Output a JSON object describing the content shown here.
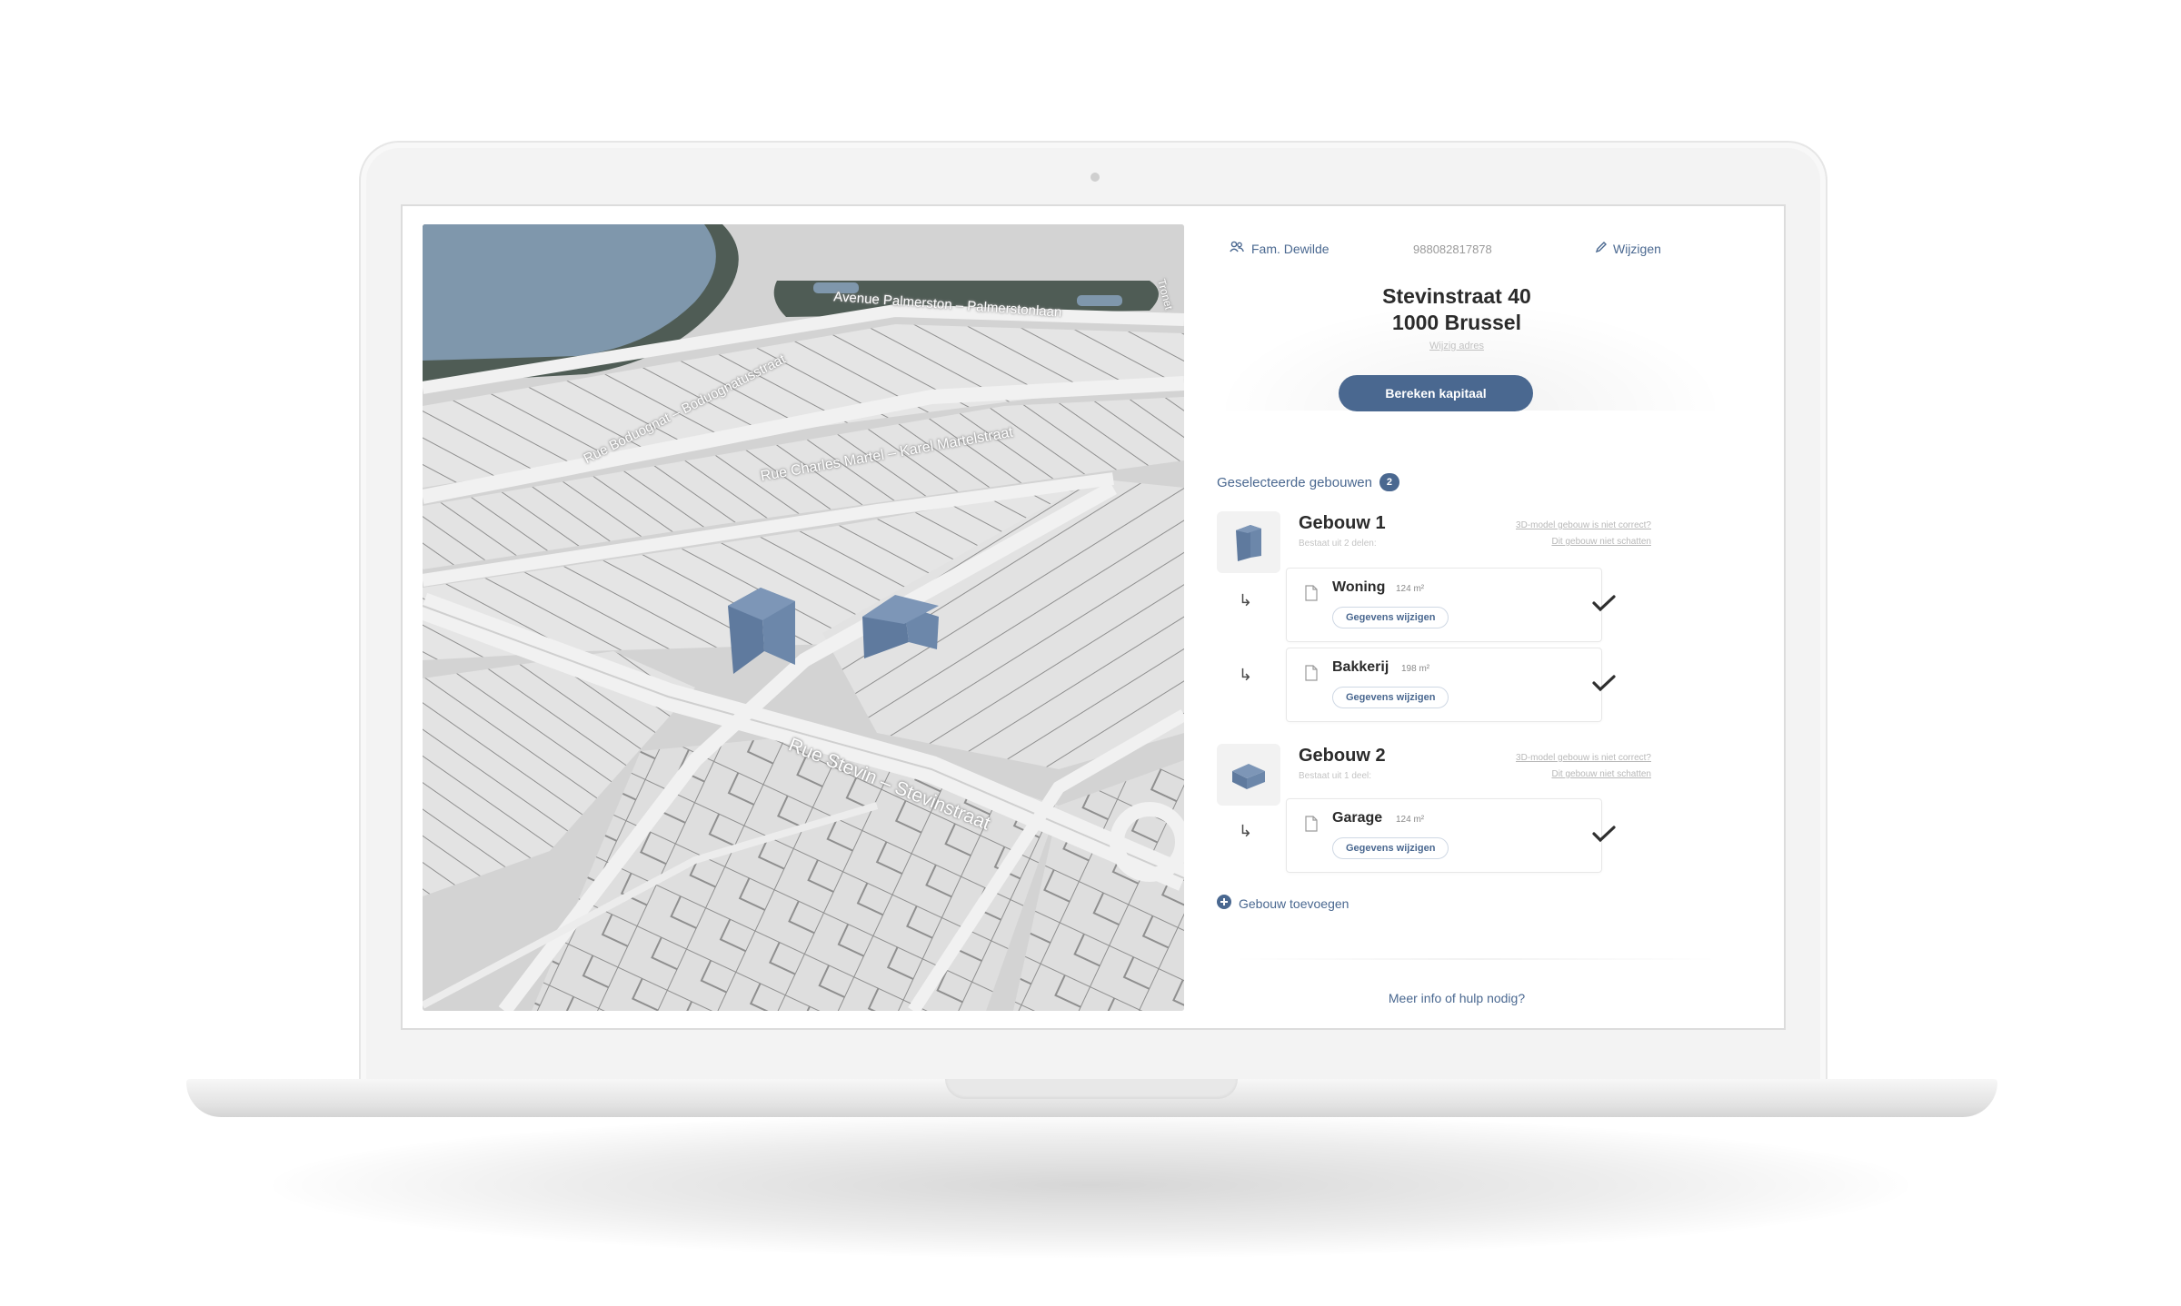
{
  "colors": {
    "accent": "#4a6890",
    "building": "#5f7a9e",
    "water": "#7f97ac",
    "park": "#4f5c55",
    "map_bg": "#d9d9d9"
  },
  "map": {
    "streets": {
      "palmerston": "Avenue Palmerston – Palmerstonlaan",
      "boduognat": "Rue Boduognat – Boduognatusstraat",
      "charles_martel": "Rue Charles Martel – Karel Martelstraat",
      "stevin": "Rue Stevin – Stevinstraat",
      "edge": "Tronet"
    }
  },
  "header": {
    "client_name": "Fam. Dewilde",
    "reference": "988082817878",
    "edit_label": "Wijzigen"
  },
  "address": {
    "line1": "Stevinstraat 40",
    "line2": "1000 Brussel",
    "edit_link": "Wijzig adres"
  },
  "calc_button": "Bereken kapitaal",
  "selected": {
    "title": "Geselecteerde gebouwen",
    "count": "2"
  },
  "buildings": [
    {
      "name": "Gebouw 1",
      "subtitle": "Bestaat uit 2 delen:",
      "link1": "3D-model gebouw is niet correct?",
      "link2": "Dit gebouw niet schatten",
      "parts": [
        {
          "name": "Woning",
          "area": "124 m²",
          "edit": "Gegevens wijzigen"
        },
        {
          "name": "Bakkerij",
          "area": "198 m²",
          "edit": "Gegevens wijzigen"
        }
      ]
    },
    {
      "name": "Gebouw 2",
      "subtitle": "Bestaat uit 1 deel:",
      "link1": "3D-model gebouw is niet correct?",
      "link2": "Dit gebouw niet schatten",
      "parts": [
        {
          "name": "Garage",
          "area": "124 m²",
          "edit": "Gegevens wijzigen"
        }
      ]
    }
  ],
  "arrow_glyph": "↳",
  "add_building": "Gebouw toevoegen",
  "help_link": "Meer info of hulp nodig?"
}
